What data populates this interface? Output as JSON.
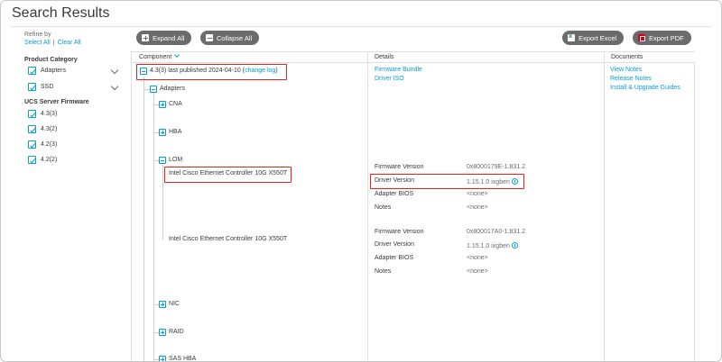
{
  "page": {
    "title": "Search Results"
  },
  "sidebar": {
    "refine_label": "Refine by",
    "select_all": "Select All",
    "separator": "|",
    "clear_all": "Clear All",
    "product_category": {
      "heading": "Product Category",
      "items": [
        {
          "label": "Adapters",
          "checked": true
        },
        {
          "label": "SSD",
          "checked": true
        }
      ]
    },
    "firmware": {
      "heading": "UCS Server Firmware",
      "items": [
        {
          "label": "4.3(3)",
          "checked": true
        },
        {
          "label": "4.3(2)",
          "checked": true
        },
        {
          "label": "4.2(3)",
          "checked": true
        },
        {
          "label": "4.2(2)",
          "checked": true
        }
      ]
    }
  },
  "toolbar": {
    "expand_all": "Expand All",
    "collapse_all": "Collapse All",
    "export_excel": "Export Excel",
    "export_pdf": "Export PDF"
  },
  "table": {
    "headers": {
      "component": "Component",
      "details": "Details",
      "documents": "Documents"
    },
    "release": {
      "label": "4.3(3) last published 2024-04-10 (",
      "change_log": "change log",
      "suffix": ")"
    },
    "release_details": {
      "firmware_bundle": "Firmware Bundle",
      "driver_iso": "Driver ISO"
    },
    "documents": {
      "view_notes": "View Notes",
      "release_notes": "Release Notes",
      "install_guides": "Install & Upgrade Guides"
    },
    "tree": {
      "adapters": "Adapters",
      "cna": "CNA",
      "hba": "HBA",
      "lom": "LOM",
      "lom_item_1": "Intel Cisco Ethernet Controller 10G X550T",
      "lom_item_2": "Intel Cisco Ethernet Controller 10G X550T",
      "nic": "NIC",
      "raid": "RAID",
      "sas_hba": "SAS HBA"
    },
    "lom_details": [
      {
        "firmware_version_label": "Firmware Version",
        "firmware_version": "0x8000179E-1.831.2",
        "driver_version_label": "Driver Version",
        "driver_version": "1.15.1.0 ixgben",
        "adapter_bios_label": "Adapter BIOS",
        "adapter_bios": "<none>",
        "notes_label": "Notes",
        "notes": "<none>"
      },
      {
        "firmware_version_label": "Firmware Version",
        "firmware_version": "0x800017A0-1.831.2",
        "driver_version_label": "Driver Version",
        "driver_version": "1.15.1.0 ixgben",
        "adapter_bios_label": "Adapter BIOS",
        "adapter_bios": "<none>",
        "notes_label": "Notes",
        "notes": "<none>"
      }
    ]
  },
  "colors": {
    "accent": "#049fd9",
    "highlight": "#e2231a",
    "button": "#6b6b6b"
  }
}
